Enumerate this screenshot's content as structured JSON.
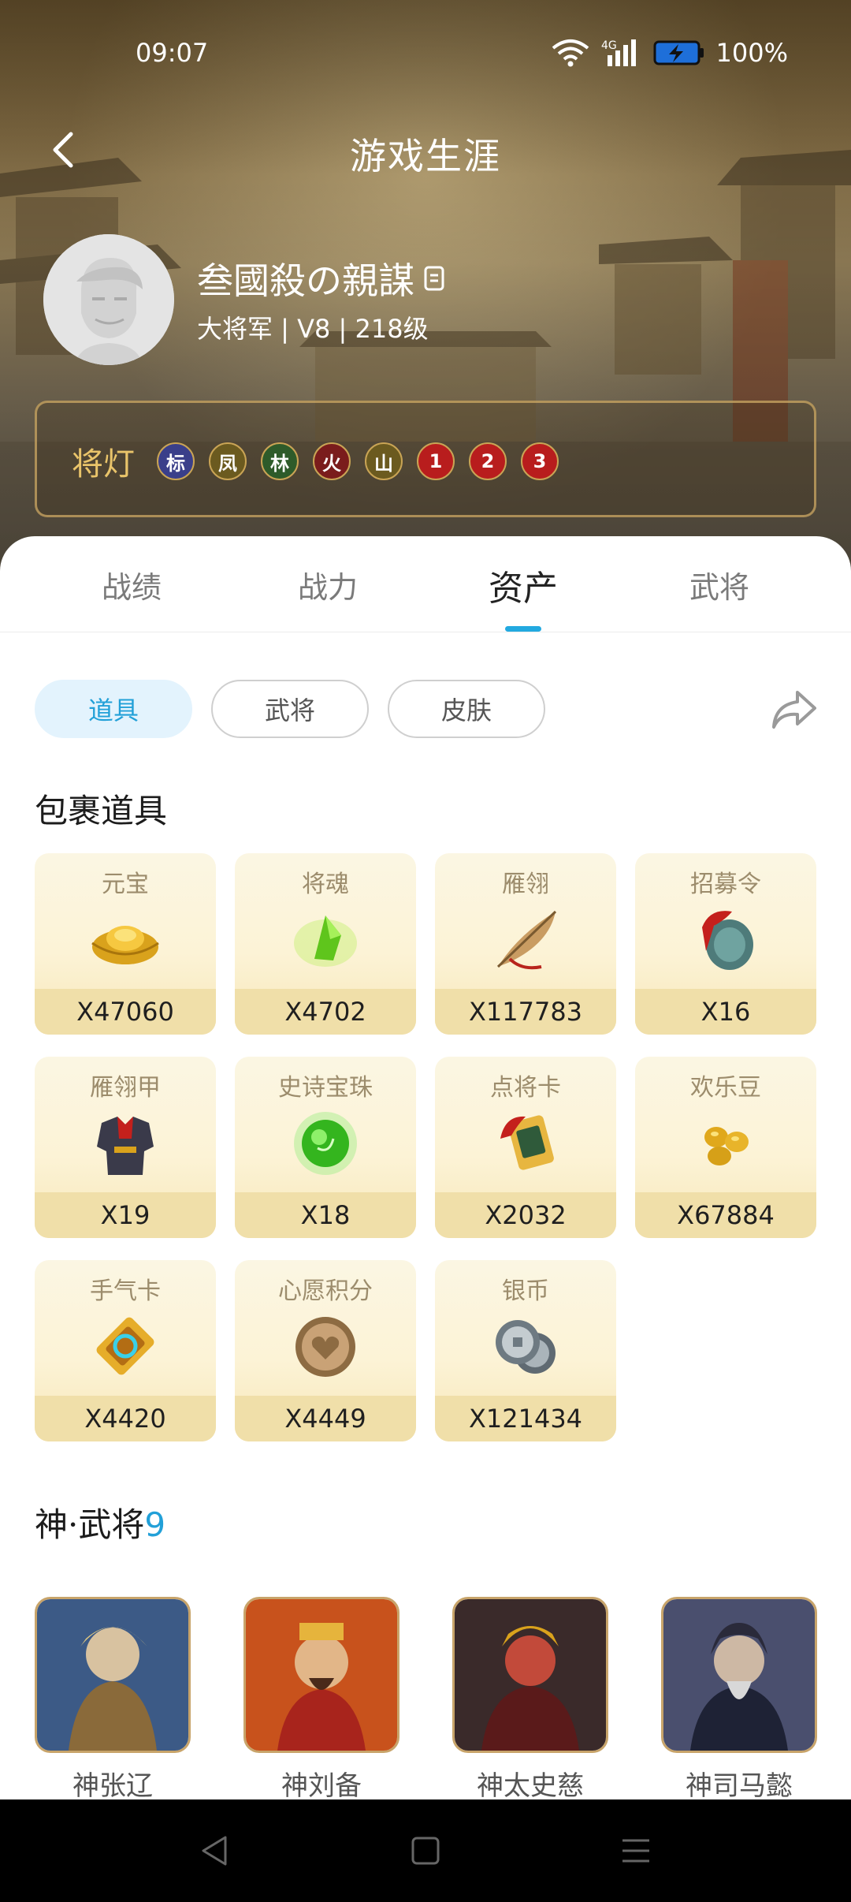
{
  "status_bar": {
    "time": "09:07",
    "battery": "100%"
  },
  "header": {
    "title": "游戏生涯"
  },
  "profile": {
    "username": "叁國殺の親謀",
    "meta": "大将军 | V8 | 218级"
  },
  "lamps": {
    "title": "将灯",
    "items": [
      {
        "label": "标",
        "color": "#3a3f8a"
      },
      {
        "label": "凤",
        "color": "#6b5a1f"
      },
      {
        "label": "林",
        "color": "#2e5b2a"
      },
      {
        "label": "火",
        "color": "#7a1c1c"
      },
      {
        "label": "山",
        "color": "#6b5a1f"
      },
      {
        "label": "1",
        "color": "#b81d1d"
      },
      {
        "label": "2",
        "color": "#b81d1d"
      },
      {
        "label": "3",
        "color": "#b81d1d"
      }
    ]
  },
  "tabs": [
    {
      "label": "战绩",
      "active": false
    },
    {
      "label": "战力",
      "active": false
    },
    {
      "label": "资产",
      "active": true
    },
    {
      "label": "武将",
      "active": false
    }
  ],
  "subtabs": [
    {
      "label": "道具",
      "active": true
    },
    {
      "label": "武将",
      "active": false
    },
    {
      "label": "皮肤",
      "active": false
    }
  ],
  "inventory": {
    "title": "包裹道具",
    "items": [
      {
        "name": "元宝",
        "qty": "X47060",
        "icon": "gold-ingot-icon"
      },
      {
        "name": "将魂",
        "qty": "X4702",
        "icon": "green-crystal-icon"
      },
      {
        "name": "雁翎",
        "qty": "X117783",
        "icon": "feather-icon"
      },
      {
        "name": "招募令",
        "qty": "X16",
        "icon": "recruit-token-icon"
      },
      {
        "name": "雁翎甲",
        "qty": "X19",
        "icon": "armor-icon"
      },
      {
        "name": "史诗宝珠",
        "qty": "X18",
        "icon": "green-orb-icon"
      },
      {
        "name": "点将卡",
        "qty": "X2032",
        "icon": "general-card-icon"
      },
      {
        "name": "欢乐豆",
        "qty": "X67884",
        "icon": "beans-icon"
      },
      {
        "name": "手气卡",
        "qty": "X4420",
        "icon": "luck-card-icon"
      },
      {
        "name": "心愿积分",
        "qty": "X4449",
        "icon": "heart-coin-icon"
      },
      {
        "name": "银币",
        "qty": "X121434",
        "icon": "silver-coin-icon"
      }
    ]
  },
  "generals": {
    "title": "神·武将",
    "count": "9",
    "items": [
      {
        "name": "神张辽",
        "accent": "#8a6a3a"
      },
      {
        "name": "神刘备",
        "accent": "#b4431c"
      },
      {
        "name": "神太史慈",
        "accent": "#7a2020"
      },
      {
        "name": "神司马懿",
        "accent": "#4a4f6e"
      }
    ]
  }
}
